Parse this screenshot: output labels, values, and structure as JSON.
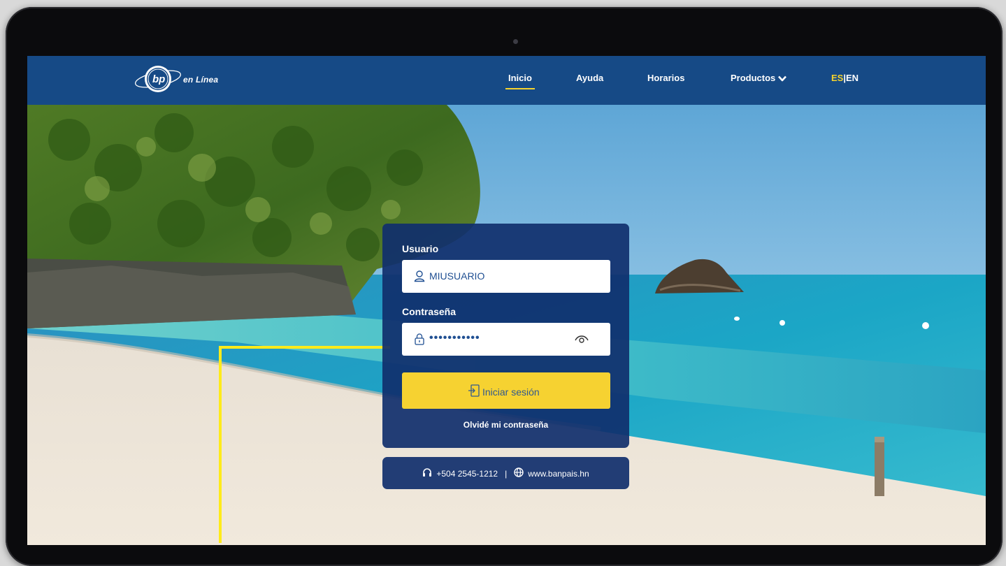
{
  "brand": {
    "logo_mark": "bp",
    "logo_text": "en Línea"
  },
  "nav": {
    "items": [
      {
        "label": "Inicio",
        "active": true
      },
      {
        "label": "Ayuda",
        "active": false
      },
      {
        "label": "Horarios",
        "active": false
      },
      {
        "label": "Productos",
        "active": false
      }
    ],
    "lang_es": "ES",
    "lang_separator": "|",
    "lang_en": "EN",
    "active_lang": "ES"
  },
  "login": {
    "user_label": "Usuario",
    "user_value": "MIUSUARIO",
    "password_label": "Contraseña",
    "password_mask": "•••••••••••",
    "submit_label": "Iniciar sesión",
    "forgot_label": "Olvidé mi contraseña"
  },
  "contact": {
    "phone": "+504 2545-1212",
    "separator": "|",
    "website": "www.banpais.hn"
  },
  "colors": {
    "navbar": "#164a86",
    "card": "#102f6c",
    "accent_yellow": "#f6d231",
    "callout": "#ffeb1a",
    "input_text": "#1f4f92"
  },
  "icons": [
    "user-icon",
    "lock-icon",
    "eye-icon",
    "login-icon",
    "headset-icon",
    "globe-icon",
    "chevron-down-icon"
  ]
}
